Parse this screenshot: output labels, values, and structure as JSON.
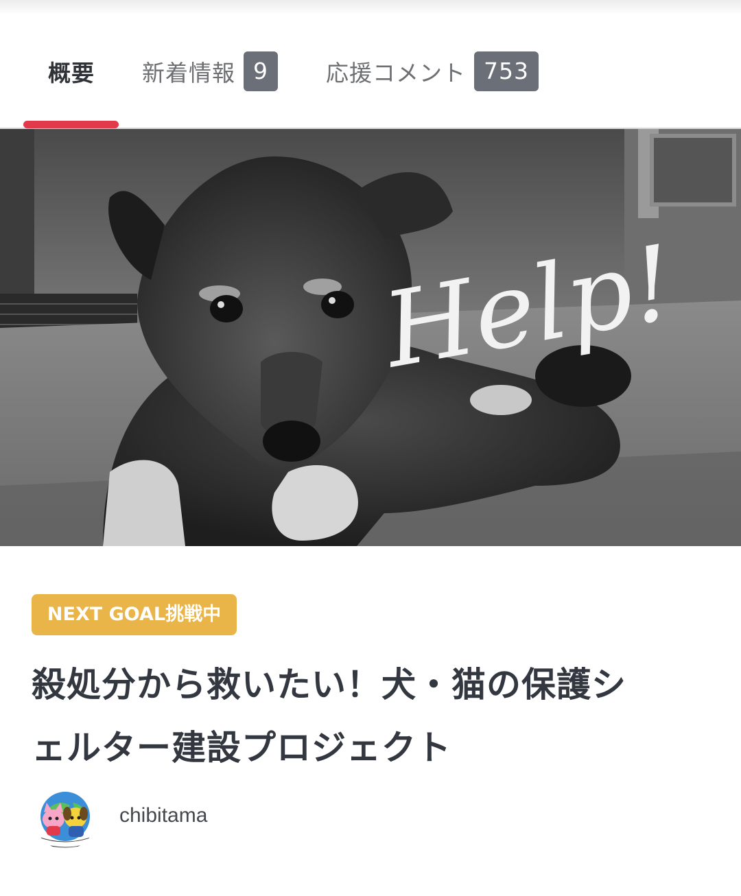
{
  "tabs": [
    {
      "label": "概要",
      "active": true
    },
    {
      "label": "新着情報",
      "count": "9"
    },
    {
      "label": "応援コメント",
      "count": "753"
    }
  ],
  "hero": {
    "overlay_text": "Help!",
    "icon": "dog-photo"
  },
  "project": {
    "status_badge": "NEXT GOAL挑戦中",
    "title_line1": "殺処分から救いたい！犬・猫の保護シ",
    "title_line2": "ェルター建設プロジェクト"
  },
  "owner": {
    "name": "chibitama",
    "avatar_icon": "mascot-avatar"
  },
  "colors": {
    "accent": "#e2394b",
    "badge_gray": "#6b6f77",
    "goal_yellow": "#e9b448",
    "text": "#333840"
  }
}
